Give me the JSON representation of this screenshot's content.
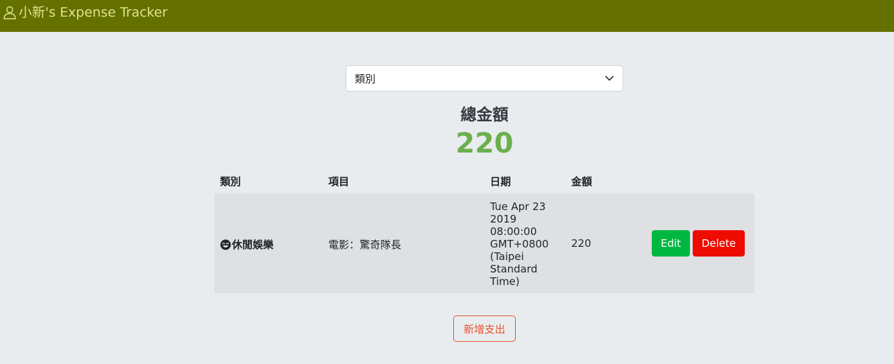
{
  "app": {
    "title": "小新's Expense Tracker",
    "brand_icon": "user-icon"
  },
  "filter": {
    "selected": "類別",
    "icon": "chevron-down-icon"
  },
  "total": {
    "label": "總金額",
    "amount": "220",
    "color": "#6ab04c"
  },
  "table": {
    "headers": [
      "類別",
      "項目",
      "日期",
      "金額"
    ],
    "rows": [
      {
        "category_icon": "laughing-face-icon",
        "category": "休閒娛樂",
        "item": "電影：驚奇隊長",
        "date": "Tue Apr 23 2019 08:00:00 GMT+0800 (Taipei Standard Time)",
        "amount": "220",
        "edit_label": "Edit",
        "delete_label": "Delete"
      }
    ]
  },
  "actions": {
    "add_label": "新增支出"
  },
  "colors": {
    "navbar": "#647000",
    "brand_text": "#dde58c",
    "edit": "#00b841",
    "delete": "#ee0c00",
    "add": "#e8542d"
  }
}
